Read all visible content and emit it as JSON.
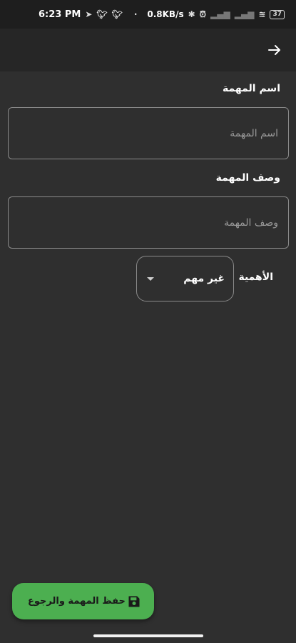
{
  "status_bar": {
    "time": "6:23 PM",
    "network_speed": "0.8KB/s",
    "battery": "37",
    "icons": [
      "telegram-icon",
      "twitter-icon",
      "twitter-icon",
      "dot-icon",
      "bluetooth-icon",
      "alarm-icon",
      "signal-icon",
      "signal-icon",
      "wifi-icon",
      "battery-icon"
    ]
  },
  "app_bar": {
    "back_icon": "arrow-right-icon"
  },
  "form": {
    "name_label": "اسم المهمة",
    "name_placeholder": "اسم المهمة",
    "description_label": "وصف المهمة",
    "description_placeholder": "وصف المهمة",
    "priority_label": "الأهمية",
    "priority_value": "غير مهم"
  },
  "fab": {
    "label": "حفظ المهمة والرجوع",
    "icon": "save-icon",
    "color": "#4caf50"
  }
}
